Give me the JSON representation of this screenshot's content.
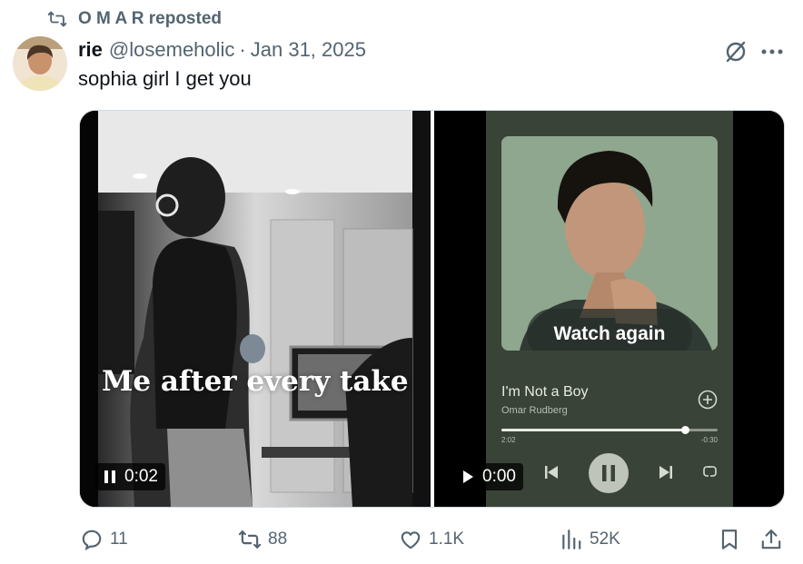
{
  "repost": {
    "label": "O M A R reposted",
    "icon": "repost-icon"
  },
  "author": {
    "name": "rie",
    "handle": "@losemeholic",
    "separator": "·",
    "date": "Jan 31, 2025"
  },
  "tweet": {
    "text": "sophia girl I get you"
  },
  "video_left": {
    "caption": "Me after every take",
    "timer": "0:02",
    "state_icon": "pause-icon"
  },
  "video_right": {
    "timer": "0:00",
    "state_icon": "play-icon",
    "overlay": {
      "watch_again_label": "Watch again"
    },
    "player": {
      "song_title": "I'm Not a Boy",
      "artist": "Omar Rudberg",
      "elapsed": "2:02",
      "remaining": "-0:30",
      "progress": 0.85
    }
  },
  "actions": {
    "replies": "11",
    "reposts": "88",
    "likes": "1.1K",
    "views": "52K"
  },
  "colors": {
    "secondary_text": "#536471",
    "primary_text": "#0f1419",
    "spotify_bg": "#3a4337"
  }
}
